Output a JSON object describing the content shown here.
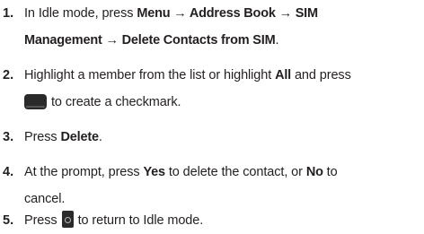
{
  "steps": [
    {
      "num": "1.",
      "parts": {
        "t1": "In Idle mode, press ",
        "b1": "Menu",
        "arrow1": " → ",
        "b2": "Address Book",
        "arrow2": " → ",
        "b3": "SIM",
        "b3b": "Management",
        "arrow3": " → ",
        "b4": "Delete Contacts from SIM",
        "t2": "."
      }
    },
    {
      "num": "2.",
      "parts": {
        "t1": "Highlight a member from the list or highlight ",
        "b1": "All",
        "t2": " and press",
        "t3": "to create a checkmark."
      },
      "icon": "menu-key-icon"
    },
    {
      "num": "3.",
      "parts": {
        "t1": "Press ",
        "b1": "Delete",
        "t2": "."
      }
    },
    {
      "num": "4.",
      "parts": {
        "t1": "At the prompt, press ",
        "b1": "Yes",
        "t2": " to delete the contact, or ",
        "b2": "No",
        "t3": " to",
        "t4": "cancel."
      }
    },
    {
      "num": "5.",
      "parts": {
        "t1": "Press",
        "t2": "to return to Idle mode."
      },
      "icon": "end-key-icon"
    }
  ]
}
